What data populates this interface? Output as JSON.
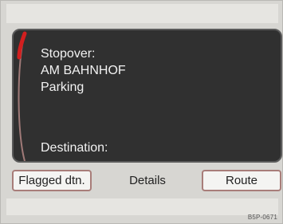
{
  "panel": {
    "stopover_label": "Stopover:",
    "stopover_name": "AM BAHNHOF",
    "stopover_type": "Parking",
    "destination_label": "Destination:"
  },
  "buttons": {
    "flagged": "Flagged dtn.",
    "details": "Details",
    "route": "Route"
  },
  "image_code": "B5P-0671",
  "colors": {
    "screen_background": "#303030",
    "button_border": "#a87d79",
    "accent_red": "#d21f1f"
  }
}
